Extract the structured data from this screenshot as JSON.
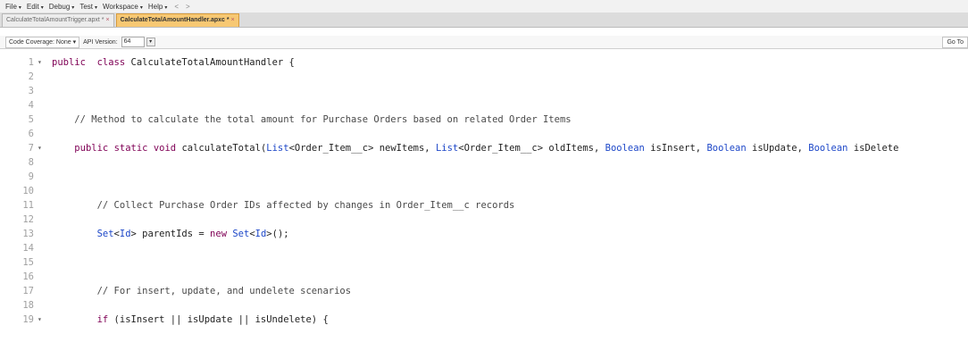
{
  "menu": {
    "items": [
      "File",
      "Edit",
      "Debug",
      "Test",
      "Workspace",
      "Help"
    ],
    "back": "<",
    "forward": ">"
  },
  "tabs": [
    {
      "label": "CalculateTotalAmountTrigger.apxt *",
      "close": "×",
      "active": false
    },
    {
      "label": "CalculateTotalAmountHandler.apxc *",
      "close": "×",
      "active": true
    }
  ],
  "toolbar": {
    "coverage_label": "Code Coverage: None",
    "api_label": "API Version:",
    "api_value": "64",
    "goto_label": "Go To"
  },
  "editor": {
    "lines": [
      {
        "n": "1",
        "fold": "▾",
        "segs": [
          [
            "kw",
            "public"
          ],
          [
            "",
            "  "
          ],
          [
            "kw",
            "class"
          ],
          [
            "",
            " CalculateTotalAmountHandler {"
          ]
        ]
      },
      {
        "n": "2",
        "fold": "",
        "segs": []
      },
      {
        "n": "3",
        "fold": "",
        "segs": []
      },
      {
        "n": "4",
        "fold": "",
        "segs": []
      },
      {
        "n": "5",
        "fold": "",
        "segs": [
          [
            "",
            "    "
          ],
          [
            "cm",
            "// Method to calculate the total amount for Purchase Orders based on related Order Items"
          ]
        ]
      },
      {
        "n": "6",
        "fold": "",
        "segs": []
      },
      {
        "n": "7",
        "fold": "▾",
        "segs": [
          [
            "",
            "    "
          ],
          [
            "kw",
            "public"
          ],
          [
            "",
            " "
          ],
          [
            "kw",
            "static"
          ],
          [
            "",
            " "
          ],
          [
            "kw",
            "void"
          ],
          [
            "",
            " calculateTotal("
          ],
          [
            "ty",
            "List"
          ],
          [
            "",
            "<Order_Item__c> newItems, "
          ],
          [
            "ty",
            "List"
          ],
          [
            "",
            "<Order_Item__c> oldItems, "
          ],
          [
            "ty",
            "Boolean"
          ],
          [
            "",
            " isInsert, "
          ],
          [
            "ty",
            "Boolean"
          ],
          [
            "",
            " isUpdate, "
          ],
          [
            "ty",
            "Boolean"
          ],
          [
            "",
            " isDelete"
          ]
        ]
      },
      {
        "n": "8",
        "fold": "",
        "segs": []
      },
      {
        "n": "9",
        "fold": "",
        "segs": []
      },
      {
        "n": "10",
        "fold": "",
        "segs": []
      },
      {
        "n": "11",
        "fold": "",
        "segs": [
          [
            "",
            "        "
          ],
          [
            "cm",
            "// Collect Purchase Order IDs affected by changes in Order_Item__c records"
          ]
        ]
      },
      {
        "n": "12",
        "fold": "",
        "segs": []
      },
      {
        "n": "13",
        "fold": "",
        "segs": [
          [
            "",
            "        "
          ],
          [
            "ty",
            "Set"
          ],
          [
            "",
            "<"
          ],
          [
            "ty",
            "Id"
          ],
          [
            "",
            "> parentIds = "
          ],
          [
            "kw",
            "new"
          ],
          [
            "",
            " "
          ],
          [
            "ty",
            "Set"
          ],
          [
            "",
            "<"
          ],
          [
            "ty",
            "Id"
          ],
          [
            "",
            ">();"
          ]
        ]
      },
      {
        "n": "14",
        "fold": "",
        "segs": []
      },
      {
        "n": "15",
        "fold": "",
        "segs": []
      },
      {
        "n": "16",
        "fold": "",
        "segs": []
      },
      {
        "n": "17",
        "fold": "",
        "segs": [
          [
            "",
            "        "
          ],
          [
            "cm",
            "// For insert, update, and undelete scenarios"
          ]
        ]
      },
      {
        "n": "18",
        "fold": "",
        "segs": []
      },
      {
        "n": "19",
        "fold": "▾",
        "segs": [
          [
            "",
            "        "
          ],
          [
            "kw",
            "if"
          ],
          [
            "",
            " (isInsert || isUpdate || isUndelete) {"
          ]
        ]
      }
    ]
  }
}
